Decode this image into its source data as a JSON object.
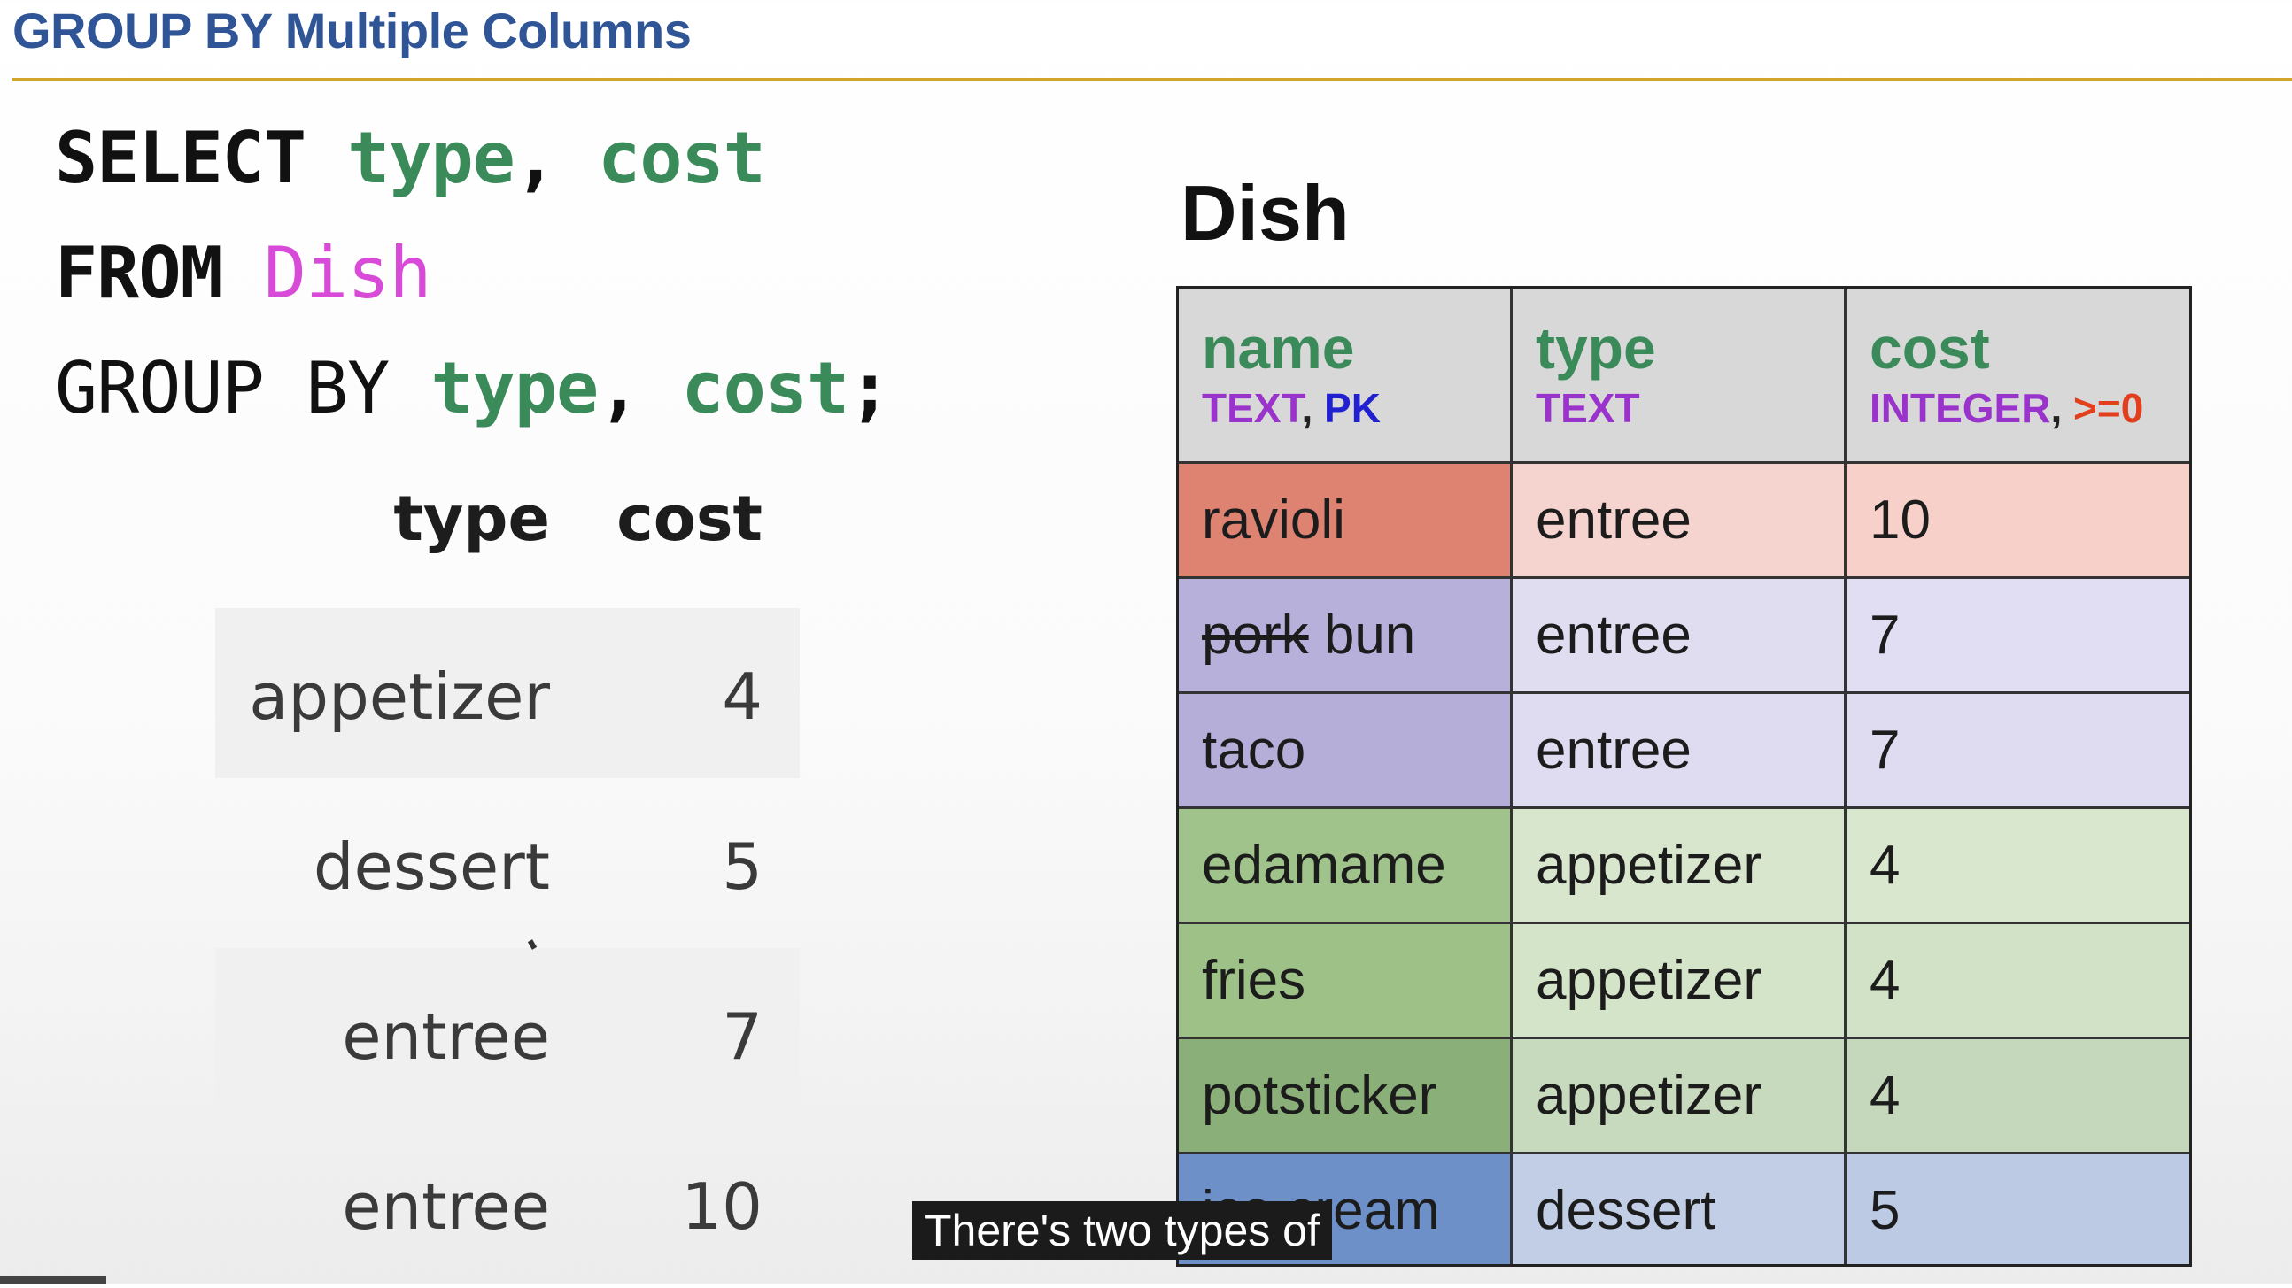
{
  "slide": {
    "title": "GROUP BY Multiple Columns"
  },
  "query": {
    "select_kw": "SELECT",
    "select_cols": [
      "type",
      "cost"
    ],
    "from_kw": "FROM",
    "table": "Dish",
    "group_kw": "GROUP BY",
    "group_cols": [
      "type",
      "cost"
    ],
    "comma": ",",
    "terminator": ";"
  },
  "result": {
    "headers": [
      "type",
      "cost"
    ],
    "rows": [
      {
        "type": "appetizer",
        "cost": "4"
      },
      {
        "type": "dessert",
        "cost": "5"
      },
      {
        "type": "entree",
        "cost": "7"
      },
      {
        "type": "entree",
        "cost": "10"
      }
    ]
  },
  "dish": {
    "title": "Dish",
    "columns": [
      {
        "name": "name",
        "dtype": "TEXT",
        "sep": ", ",
        "constraint": "PK"
      },
      {
        "name": "type",
        "dtype": "TEXT",
        "sep": "",
        "constraint": ""
      },
      {
        "name": "cost",
        "dtype": "INTEGER",
        "sep": ", ",
        "constraint": ">=0"
      }
    ],
    "rows": [
      {
        "name": "ravioli",
        "type": "entree",
        "cost": "10"
      },
      {
        "name_struck": "pork",
        "name_rest": " bun",
        "type": "entree",
        "cost": "7"
      },
      {
        "name": "taco",
        "type": "entree",
        "cost": "7"
      },
      {
        "name": "edamame",
        "type": "appetizer",
        "cost": "4"
      },
      {
        "name": "fries",
        "type": "appetizer",
        "cost": "4"
      },
      {
        "name": "potsticker",
        "type": "appetizer",
        "cost": "4"
      },
      {
        "name": "ice cream",
        "type": "dessert",
        "cost": "5"
      }
    ],
    "row_colors": [
      [
        "#DE8272",
        "#F5D3CE",
        "#F7D0CA"
      ],
      [
        "#B6B0DB",
        "#E0DDF1",
        "#E1DDF2"
      ],
      [
        "#B4AED9",
        "#DFDBF0",
        "#DFDBF0"
      ],
      [
        "#9FC38A",
        "#D8E6CE",
        "#D9E7CF"
      ],
      [
        "#9DC187",
        "#D4E4C9",
        "#D2E2C7"
      ],
      [
        "#8AAF78",
        "#C8DABD",
        "#C6D8BB"
      ],
      [
        "#6E90C8",
        "#C2CEE6",
        "#BCCAE4"
      ]
    ]
  },
  "caption": "There's two types of",
  "colors": {
    "title": "#2F5597",
    "rule": "#D4A32A",
    "sql_column": "#3B8A5A",
    "sql_table": "#D84BD8",
    "header_bg": "#D8D8D8"
  }
}
